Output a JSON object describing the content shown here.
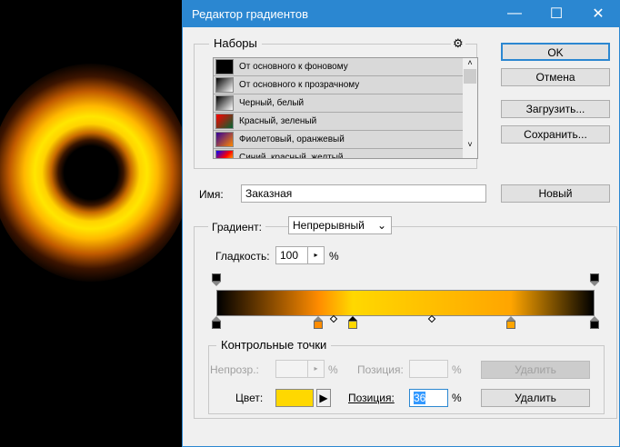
{
  "window": {
    "title": "Редактор градиентов",
    "minimize": "—",
    "maximize": "☐",
    "close": "✕"
  },
  "presets": {
    "label": "Наборы",
    "gear": "⚙",
    "items": [
      {
        "label": "От основного к фоновому",
        "swatch": "linear-gradient(135deg,#000,#000)"
      },
      {
        "label": "От основного к прозрачному",
        "swatch": "linear-gradient(135deg,#000,#ccc 80%,#fff)"
      },
      {
        "label": "Черный, белый",
        "swatch": "linear-gradient(135deg,#000,#fff)"
      },
      {
        "label": "Красный, зеленый",
        "swatch": "linear-gradient(135deg,#f00,#063)"
      },
      {
        "label": "Фиолетовый, оранжевый",
        "swatch": "linear-gradient(135deg,#309,#f80)"
      },
      {
        "label": "Синий, красный, желтый",
        "swatch": "linear-gradient(135deg,#00f,#f00,#ff0)"
      }
    ]
  },
  "buttons": {
    "ok": "OK",
    "cancel": "Отмена",
    "load": "Загрузить...",
    "save": "Сохранить...",
    "new": "Новый"
  },
  "name": {
    "label": "Имя:",
    "value": "Заказная"
  },
  "gradient": {
    "type_label": "Градиент:",
    "type_value": "Непрерывный",
    "smooth_label": "Гладкость:",
    "smooth_value": "100",
    "percent": "%",
    "color_stops": [
      {
        "position": 0,
        "color": "#000000"
      },
      {
        "position": 27,
        "color": "#ff8c00"
      },
      {
        "position": 36,
        "color": "#ffd800"
      },
      {
        "position": 78,
        "color": "#ffa500"
      },
      {
        "position": 100,
        "color": "#000000"
      }
    ],
    "opacity_stops": [
      0,
      100
    ],
    "midpoints": [
      31,
      57
    ]
  },
  "stops": {
    "label": "Контрольные точки",
    "opacity_label": "Непрозр.:",
    "opacity_pos_label": "Позиция:",
    "delete": "Удалить",
    "color_label": "Цвет:",
    "color": "#ffd800",
    "position_label": "Позиция:",
    "position_value": "36",
    "percent": "%"
  }
}
